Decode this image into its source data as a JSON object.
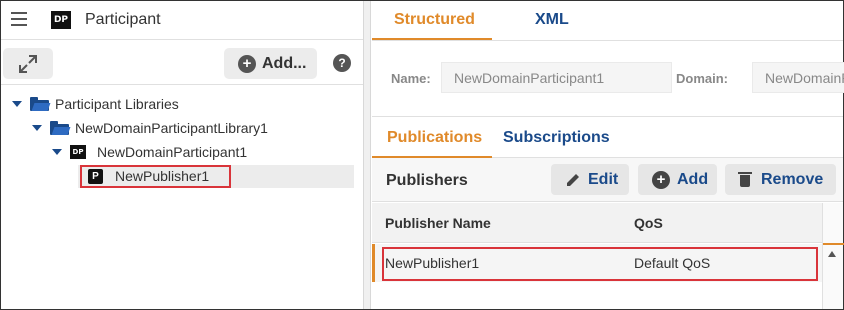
{
  "left_panel": {
    "title": "Participant",
    "dp_badge": "DP",
    "add_button": "Add...",
    "help": "?",
    "tree": [
      {
        "label": "Participant Libraries",
        "icon": "folder-open-icon"
      },
      {
        "label": "NewDomainParticipantLibrary1",
        "icon": "folder-open-icon"
      },
      {
        "label": "NewDomainParticipant1",
        "icon": "domain-participant-icon",
        "badge": "DP"
      },
      {
        "label": "NewPublisher1",
        "icon": "publisher-icon",
        "badge": "P",
        "selected": true
      }
    ]
  },
  "right_panel": {
    "tabs": [
      "Structured",
      "XML"
    ],
    "active_tab": "Structured",
    "name_label": "Name:",
    "name_value": "NewDomainParticipant1",
    "domain_label": "Domain:",
    "domain_value": "NewDomainP",
    "sub_tabs": [
      "Publications",
      "Subscriptions"
    ],
    "active_sub_tab": "Publications",
    "section_title": "Publishers",
    "buttons": {
      "edit": "Edit",
      "add": "Add",
      "remove": "Remove"
    },
    "table": {
      "columns": [
        "Publisher Name",
        "QoS"
      ],
      "rows": [
        {
          "name": "NewPublisher1",
          "qos": "Default QoS"
        }
      ]
    }
  },
  "colors": {
    "accent": "#e08a2a",
    "link": "#1a4a8a",
    "highlight_box": "#d9343a"
  }
}
